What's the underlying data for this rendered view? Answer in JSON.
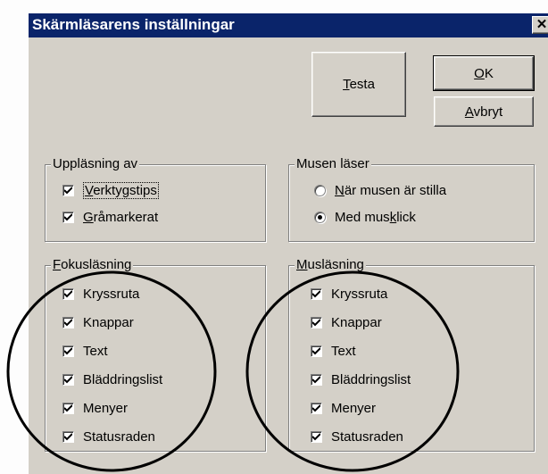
{
  "window": {
    "title": "Skärmläsarens inställningar",
    "close_symbol": "✕"
  },
  "buttons": {
    "test": {
      "pre": "",
      "mn": "T",
      "post": "esta"
    },
    "ok": {
      "pre": "",
      "mn": "O",
      "post": "K"
    },
    "cancel": {
      "pre": "",
      "mn": "A",
      "post": "vbryt"
    }
  },
  "reading_group": {
    "title": "Uppläsning av",
    "items": [
      {
        "pre": "",
        "mn": "V",
        "post": "erktygstips",
        "checked": true
      },
      {
        "pre": "",
        "mn": "G",
        "post": "råmarkerat",
        "checked": true
      }
    ]
  },
  "mouse_reads": {
    "title": "Musen läser",
    "options": [
      {
        "pre": "",
        "mn": "N",
        "post": "är musen är stilla",
        "selected": false
      },
      {
        "pre": "Med mus",
        "mn": "k",
        "post": "lick",
        "selected": true
      }
    ]
  },
  "focus_reading": {
    "title_mn": "F",
    "title_post": "okusläsning",
    "items": [
      {
        "label": "Kryssruta",
        "checked": true
      },
      {
        "label": "Knappar",
        "checked": true
      },
      {
        "label": "Text",
        "checked": true
      },
      {
        "label": "Bläddringslist",
        "checked": true
      },
      {
        "label": "Menyer",
        "checked": true
      },
      {
        "label": "Statusraden",
        "checked": true
      }
    ]
  },
  "mouse_reading": {
    "title_mn": "M",
    "title_post": "usläsning",
    "items": [
      {
        "label": "Kryssruta",
        "checked": true
      },
      {
        "label": "Knappar",
        "checked": true
      },
      {
        "label": "Text",
        "checked": true
      },
      {
        "label": "Bläddringslist",
        "checked": true
      },
      {
        "label": "Menyer",
        "checked": true
      },
      {
        "label": "Statusraden",
        "checked": true
      }
    ]
  },
  "colors": {
    "titlebar": "#0a246a",
    "face": "#d4d0c8",
    "annotation": "#000000"
  }
}
